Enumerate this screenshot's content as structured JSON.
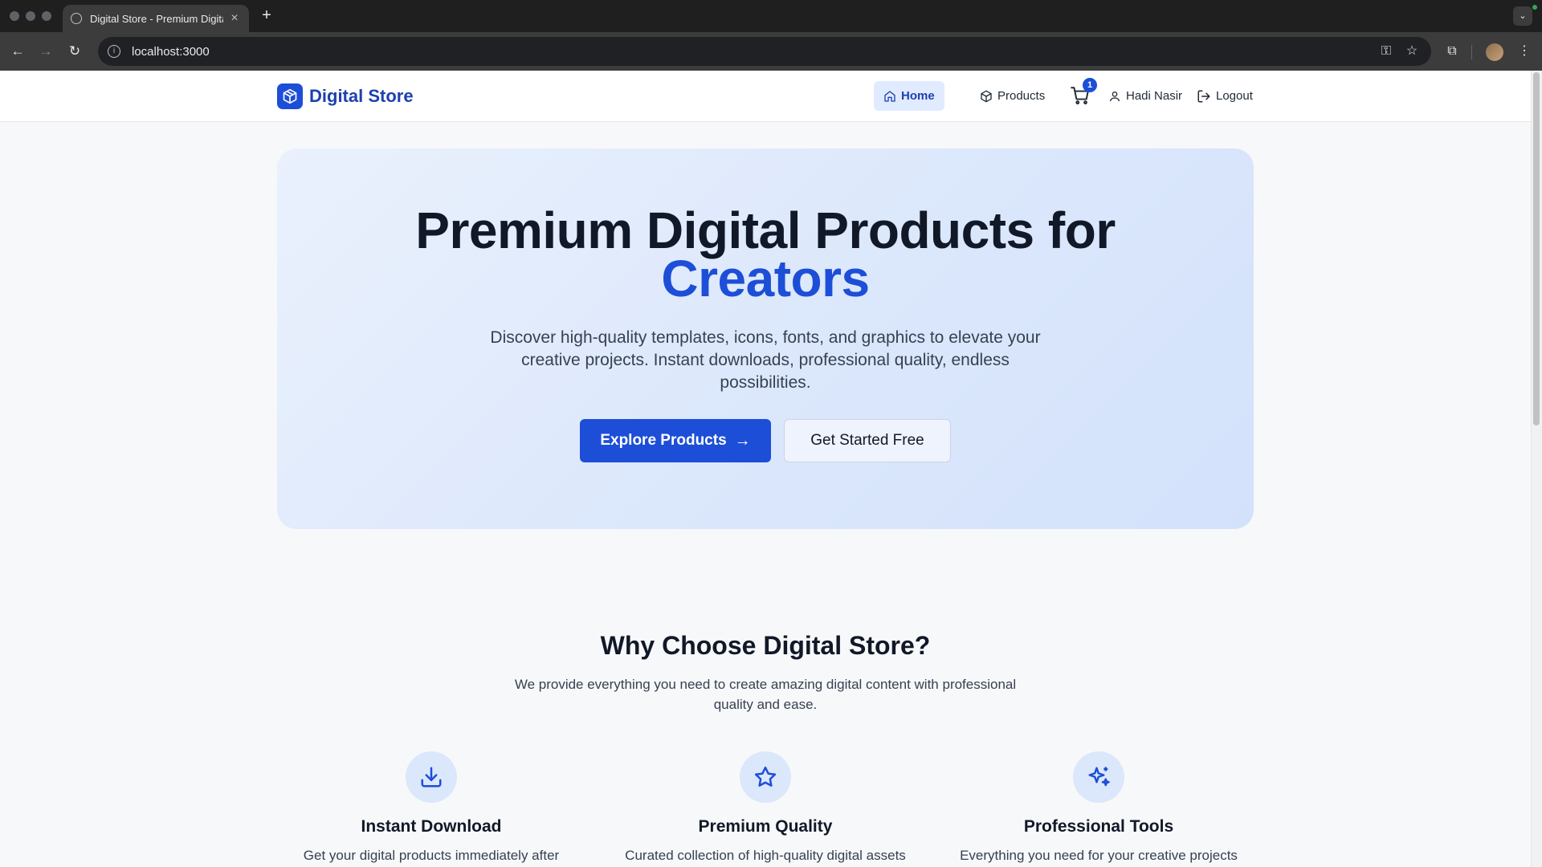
{
  "browser": {
    "tab_title": "Digital Store - Premium Digital Products",
    "url": "localhost:3000"
  },
  "header": {
    "brand": "Digital Store",
    "nav": {
      "home": "Home",
      "products": "Products",
      "cart_count": "1",
      "user": "Hadi Nasir",
      "logout": "Logout"
    }
  },
  "hero": {
    "title_line1": "Premium Digital Products for",
    "title_accent": "Creators",
    "subtitle": "Discover high-quality templates, icons, fonts, and graphics to elevate your creative projects. Instant downloads, professional quality, endless possibilities.",
    "primary_cta": "Explore Products",
    "secondary_cta": "Get Started Free"
  },
  "why": {
    "title": "Why Choose Digital Store?",
    "subtitle": "We provide everything you need to create amazing digital content with professional quality and ease."
  },
  "features": [
    {
      "icon": "download-icon",
      "title": "Instant Download",
      "desc": "Get your digital products immediately after"
    },
    {
      "icon": "star-icon",
      "title": "Premium Quality",
      "desc": "Curated collection of high-quality digital assets"
    },
    {
      "icon": "sparkles-icon",
      "title": "Professional Tools",
      "desc": "Everything you need for your creative projects"
    }
  ],
  "colors": {
    "brand": "#1d4ed8",
    "brand_dark": "#1e40af",
    "hero_bg": "#dbe7fb",
    "page_bg": "#f7f8fa"
  }
}
